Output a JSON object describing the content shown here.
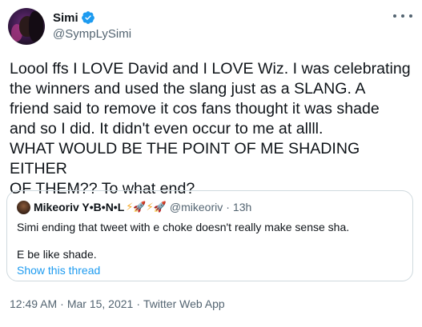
{
  "author": {
    "display_name": "Simi",
    "handle": "@SympLySimi",
    "verified": true
  },
  "tweet": {
    "text": "Loool ffs I LOVE David and I LOVE Wiz. I was celebrating\nthe winners and used the slang just as a SLANG. A\nfriend said to remove it cos fans thought it was shade\nand so I did. It didn't even occur to me at allll.\nWHAT WOULD BE THE POINT OF ME SHADING EITHER\nOF THEM?? To what end?"
  },
  "quoted_tweet": {
    "display_name": "Mikeoriv Y•B•N•L",
    "emojis": "⚡🚀⚡🚀",
    "handle": "@mikeoriv",
    "separator": "·",
    "time": "13h",
    "line1": "Simi ending that tweet with e choke doesn't really make sense sha.",
    "line2": "E be like shade.",
    "show_thread_label": "Show this thread"
  },
  "meta": {
    "time": "12:49 AM",
    "separator": "·",
    "date": "Mar 15, 2021",
    "source": "Twitter Web App"
  },
  "colors": {
    "text_primary": "#0f1419",
    "text_secondary": "#536471",
    "link": "#1d9bf0",
    "verified_badge": "#1d9bf0",
    "border": "#cfd9de"
  },
  "icons": {
    "verified": "verified-badge-icon",
    "more": "more-options-icon"
  }
}
